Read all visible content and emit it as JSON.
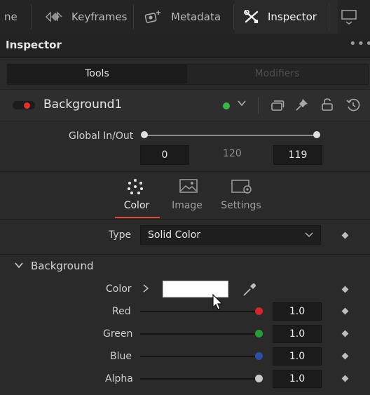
{
  "tabs": [
    {
      "label": "ne",
      "icon": null
    },
    {
      "label": "Keyframes",
      "icon": "keyframes-icon"
    },
    {
      "label": "Metadata",
      "icon": "metadata-icon"
    },
    {
      "label": "Inspector",
      "icon": "inspector-icon",
      "active": true
    }
  ],
  "header": {
    "title": "Inspector",
    "menu": "•••"
  },
  "segment": {
    "left": "Tools",
    "right": "Modifiers",
    "active": "Tools"
  },
  "node": {
    "name": "Background1",
    "status_color": "#3bb84a",
    "enable_color": "#e5322f"
  },
  "global_inout": {
    "label": "Global In/Out",
    "in": "0",
    "mid": "120",
    "out": "119"
  },
  "subtabs": [
    {
      "label": "Color",
      "icon": "color-dots-icon",
      "active": true
    },
    {
      "label": "Image",
      "icon": "image-icon"
    },
    {
      "label": "Settings",
      "icon": "settings-icon"
    }
  ],
  "type_row": {
    "label": "Type",
    "value": "Solid Color"
  },
  "section": {
    "title": "Background"
  },
  "color_row": {
    "label": "Color",
    "swatch": "#ffffff"
  },
  "channels": [
    {
      "label": "Red",
      "value": "1.0",
      "knob_color": "#d1262a"
    },
    {
      "label": "Green",
      "value": "1.0",
      "knob_color": "#2a9b3c"
    },
    {
      "label": "Blue",
      "value": "1.0",
      "knob_color": "#2d4fa3"
    },
    {
      "label": "Alpha",
      "value": "1.0",
      "knob_color": "#c9c9c9"
    }
  ],
  "accent": "#e04a3a"
}
